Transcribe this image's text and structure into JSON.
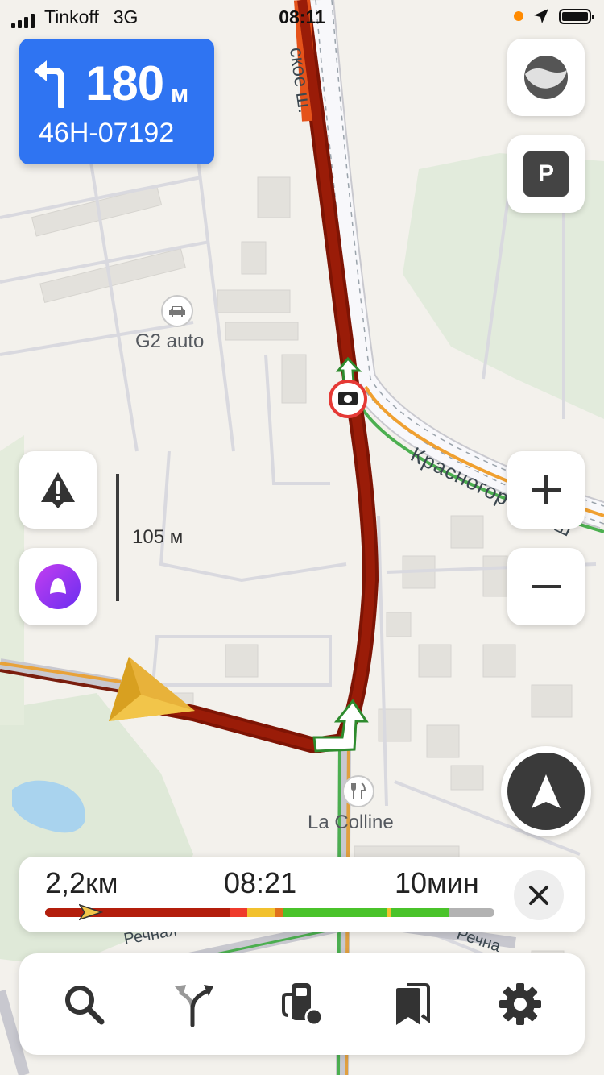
{
  "status_bar": {
    "carrier": "Tinkoff",
    "network": "3G",
    "time": "08:11",
    "icons": [
      "signal-icon",
      "location-arrow-icon",
      "battery-icon"
    ]
  },
  "maneuver": {
    "turn": "turn-left-icon",
    "distance": "180",
    "unit": "м",
    "road_number": "46Н-07192"
  },
  "map": {
    "street_labels": [
      "Красногорское ш.",
      "Красногорское ш",
      "Речная",
      "Речна"
    ],
    "poi": [
      {
        "name": "G2 auto",
        "icon": "car-icon"
      },
      {
        "name": "La Colline",
        "icon": "restaurant-icon"
      }
    ],
    "scale": "105 м"
  },
  "side_buttons": {
    "left": [
      "alert-icon",
      "alice-icon"
    ],
    "right": [
      "traffic-layer-icon",
      "parking-icon",
      "zoom-in-icon",
      "zoom-out-icon",
      "compass-icon"
    ],
    "parking_label": "P"
  },
  "route_info": {
    "remaining_distance": "2,2км",
    "arrival_time": "08:21",
    "duration": "10мин",
    "traffic": [
      {
        "from": 0.0,
        "to": 0.41,
        "color": "#b31e0c"
      },
      {
        "from": 0.41,
        "to": 0.45,
        "color": "#ef3b2c"
      },
      {
        "from": 0.45,
        "to": 0.51,
        "color": "#f2c12e"
      },
      {
        "from": 0.51,
        "to": 0.53,
        "color": "#e0701b"
      },
      {
        "from": 0.53,
        "to": 0.76,
        "color": "#4ac32a"
      },
      {
        "from": 0.76,
        "to": 0.77,
        "color": "#f2c12e"
      },
      {
        "from": 0.77,
        "to": 0.9,
        "color": "#4ac32a"
      }
    ]
  },
  "toolbar": {
    "items": [
      "search-icon",
      "route-options-icon",
      "gas-station-icon",
      "bookmarks-icon",
      "settings-icon"
    ]
  }
}
